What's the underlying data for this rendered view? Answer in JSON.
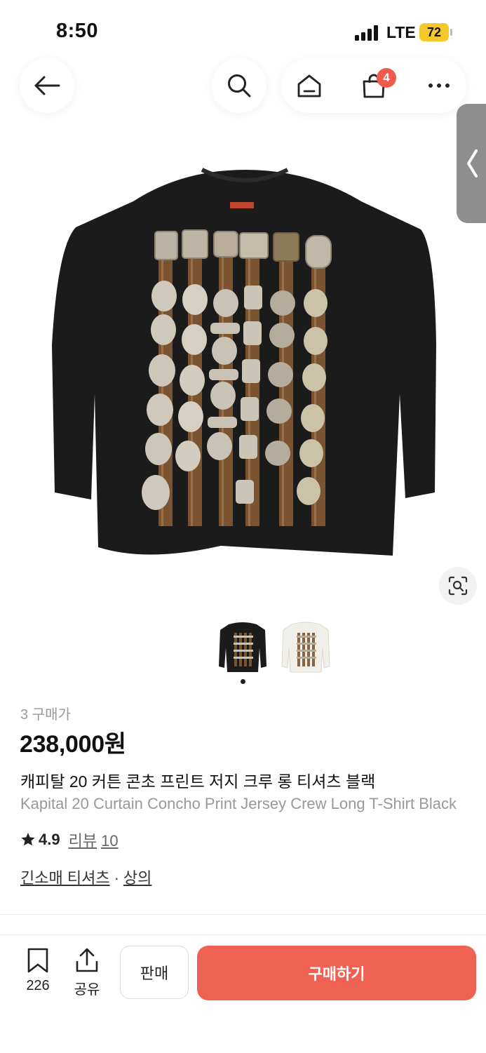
{
  "status_bar": {
    "time": "8:50",
    "network": "LTE",
    "battery": "72"
  },
  "header": {
    "back_icon": "arrow-left-icon",
    "search_icon": "search-icon",
    "home_icon": "home-icon",
    "cart_icon": "shopping-bag-icon",
    "cart_count": "4",
    "more_icon": "more-horizontal-icon"
  },
  "product": {
    "buyer_count": "3 구매가",
    "price": "238,000원",
    "title_ko": "캐피탈 20 커튼 콘초 프린트 저지 크루 롱 티셔츠 블랙",
    "title_en": "Kapital 20 Curtain Concho Print Jersey Crew Long T-Shirt Black",
    "rating": "4.9",
    "review_label": "리뷰",
    "review_count": "10",
    "category_main": "긴소매 티셔츠",
    "category_sep": "·",
    "category_sub": "상의",
    "image_count": 2,
    "selected_image_index": 0
  },
  "bottom_bar": {
    "bookmark_count": "226",
    "share_label": "공유",
    "sell_label": "판매",
    "buy_label": "구매하기"
  },
  "colors": {
    "accent": "#ef6253",
    "badge": "#ef5a4c",
    "battery": "#f6c92a"
  }
}
